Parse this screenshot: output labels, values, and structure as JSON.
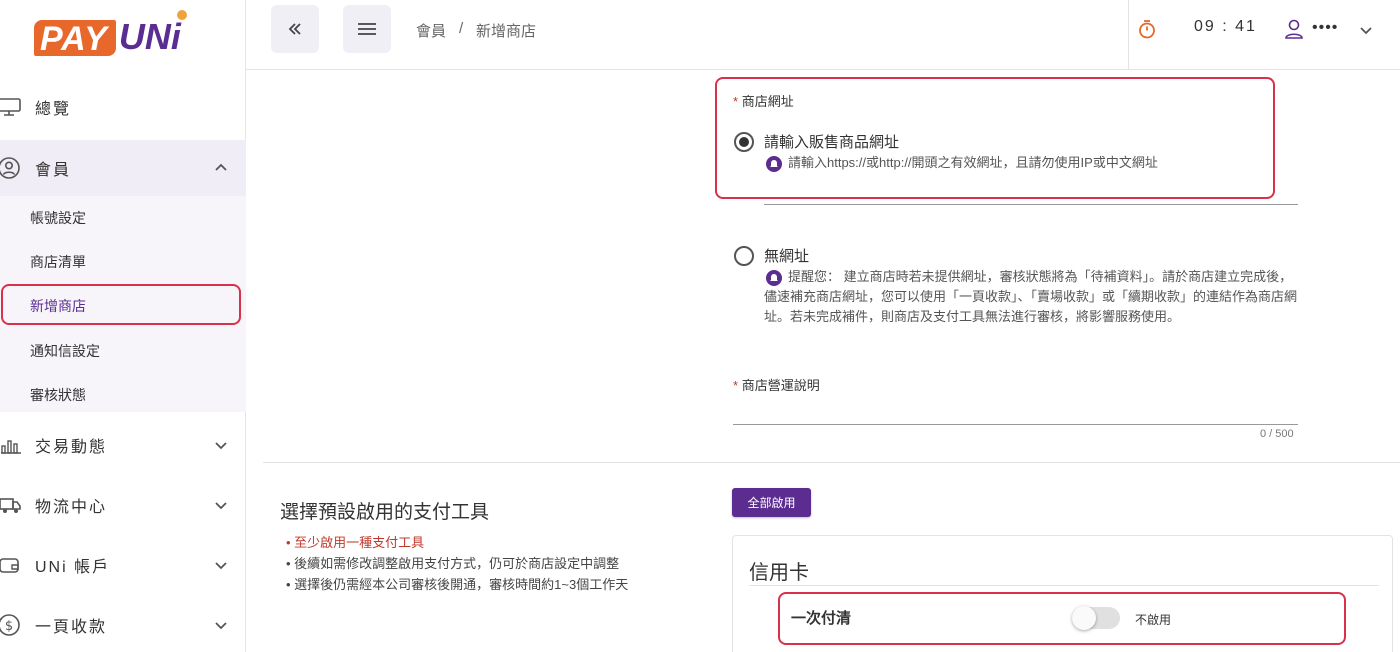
{
  "brand": {
    "logo_pay": "PAY",
    "logo_uni": "UNi"
  },
  "sidebar": {
    "items": [
      {
        "label": "總覽",
        "icon": "monitor-icon"
      },
      {
        "label": "會員",
        "icon": "user-circle-icon"
      },
      {
        "label": "交易動態",
        "icon": "bar-chart-icon"
      },
      {
        "label": "物流中心",
        "icon": "truck-icon"
      },
      {
        "label": "UNi 帳戶",
        "icon": "wallet-icon"
      },
      {
        "label": "一頁收款",
        "icon": "dollar-circle-icon"
      }
    ],
    "member_submenu": [
      "帳號設定",
      "商店清單",
      "新增商店",
      "通知信設定",
      "審核狀態"
    ]
  },
  "header": {
    "breadcrumb": {
      "parent": "會員",
      "separator": "/",
      "current": "新增商店"
    },
    "timer": "09 : 41",
    "user_masked": "••••"
  },
  "form": {
    "store_url": {
      "required_mark": "*",
      "label": "商店網址",
      "option_url_label": "請輸入販售商品網址",
      "option_url_hint": "請輸入https://或http://開頭之有效網址，且請勿使用IP或中文網址",
      "option_none_label": "無網址",
      "option_none_hint": "提醒您： 建立商店時若未提供網址，審核狀態將為「待補資料」。請於商店建立完成後，儘速補充商店網址，您可以使用「一頁收款」、「賣場收款」或「續期收款」的連結作為商店網址。若未完成補件，則商店及支付工具無法進行審核，將影響服務使用。",
      "selected": "url"
    },
    "store_description": {
      "required_mark": "*",
      "label": "商店營運說明",
      "counter": "0 / 500"
    }
  },
  "payment": {
    "title": "選擇預設啟用的支付工具",
    "notes": [
      "至少啟用一種支付工具",
      "後續如需修改調整啟用支付方式，仍可於商店設定中調整",
      "選擇後仍需經本公司審核後開通，審核時間約1~3個工作天"
    ],
    "enable_all_label": "全部啟用",
    "card_title": "信用卡",
    "option_label": "一次付清",
    "option_status": "不啟用",
    "option_enabled": false
  },
  "colors": {
    "brand_orange": "#e8672a",
    "brand_purple": "#5b2d91",
    "highlight_red": "#d7324a",
    "warning_red": "#c0392b"
  }
}
